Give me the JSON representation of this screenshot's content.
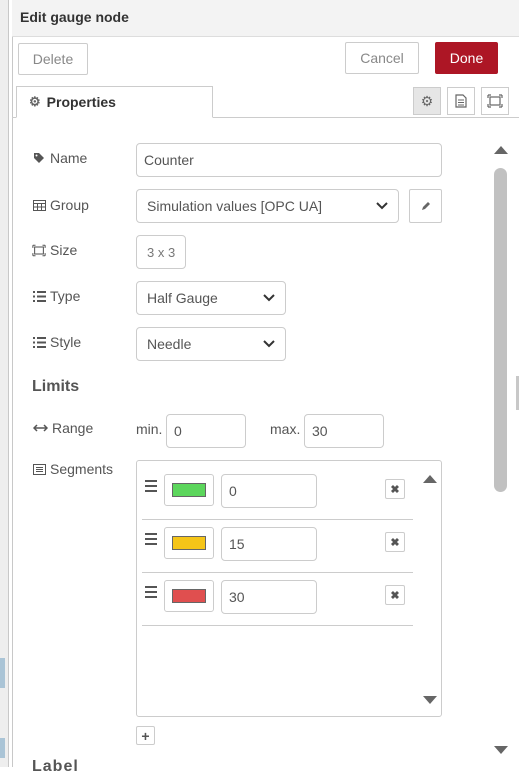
{
  "header": {
    "title": "Edit gauge node"
  },
  "actions": {
    "delete_label": "Delete",
    "cancel_label": "Cancel",
    "done_label": "Done"
  },
  "tabs": {
    "properties_label": "Properties"
  },
  "form": {
    "name": {
      "label": "Name",
      "value": "Counter"
    },
    "group": {
      "label": "Group",
      "value": "Simulation values [OPC UA]"
    },
    "size": {
      "label": "Size",
      "value": "3 x 3"
    },
    "type": {
      "label": "Type",
      "value": "Half Gauge"
    },
    "style": {
      "label": "Style",
      "value": "Needle"
    },
    "limits_title": "Limits",
    "range": {
      "label": "Range",
      "min_label": "min.",
      "min_value": "0",
      "max_label": "max.",
      "max_value": "30"
    },
    "segments": {
      "label": "Segments",
      "items": [
        {
          "color": "#5cd65c",
          "value": "0"
        },
        {
          "color": "#f5c518",
          "value": "15"
        },
        {
          "color": "#e04f4f",
          "value": "30"
        }
      ]
    },
    "cut_off_label": "Label"
  },
  "colors": {
    "accent": "#ad1625"
  }
}
